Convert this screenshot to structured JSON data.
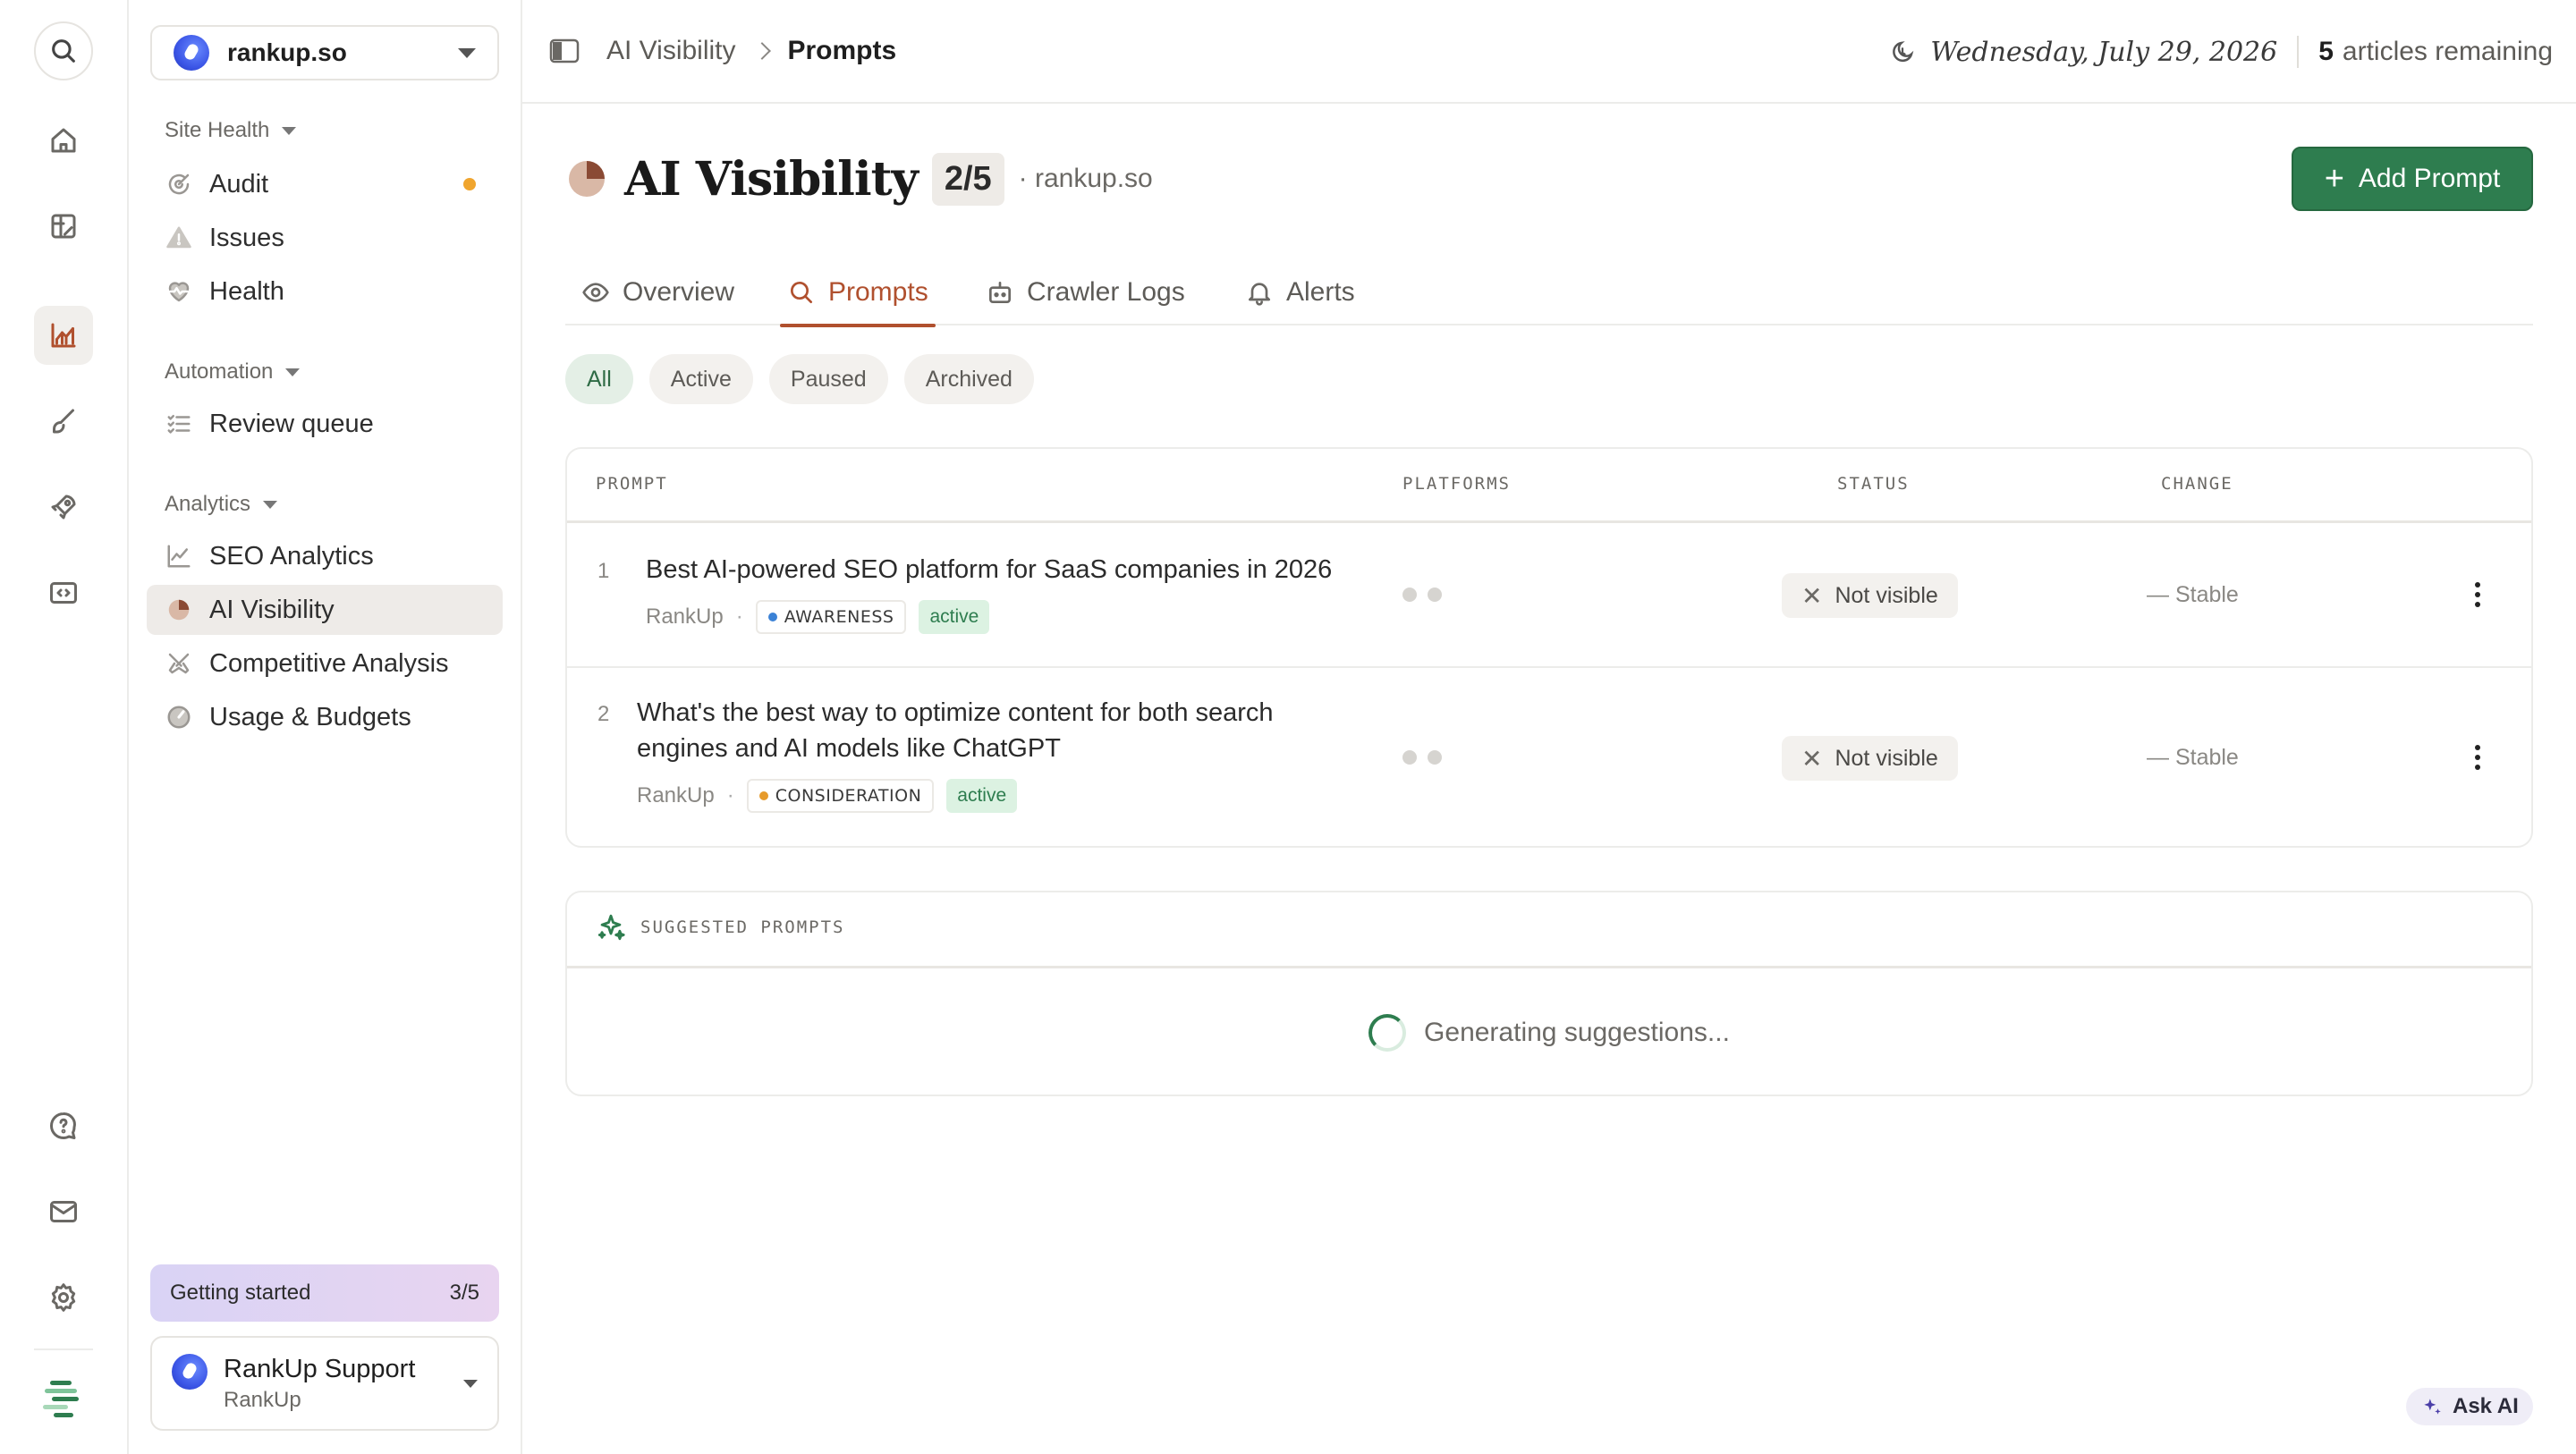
{
  "rail": {
    "items": [
      "search",
      "home",
      "content",
      "analytics",
      "write",
      "launch",
      "embed",
      "help",
      "mail",
      "settings"
    ]
  },
  "site_switcher": {
    "name": "rankup.so"
  },
  "sidebar": {
    "sections": [
      {
        "title": "Site Health",
        "items": [
          {
            "label": "Audit",
            "icon": "audit-icon",
            "indicator": true
          },
          {
            "label": "Issues",
            "icon": "warning-icon"
          },
          {
            "label": "Health",
            "icon": "heart-pulse-icon"
          }
        ]
      },
      {
        "title": "Automation",
        "items": [
          {
            "label": "Review queue",
            "icon": "checklist-icon"
          }
        ]
      },
      {
        "title": "Analytics",
        "items": [
          {
            "label": "SEO Analytics",
            "icon": "line-chart-icon"
          },
          {
            "label": "AI Visibility",
            "icon": "pie-icon",
            "active": true
          },
          {
            "label": "Competitive Analysis",
            "icon": "swords-icon"
          },
          {
            "label": "Usage & Budgets",
            "icon": "gauge-icon"
          }
        ]
      }
    ],
    "getting_started": {
      "label": "Getting started",
      "progress": "3/5"
    },
    "user": {
      "name": "RankUp Support",
      "org": "RankUp"
    }
  },
  "topbar": {
    "breadcrumb": [
      "AI Visibility",
      "Prompts"
    ],
    "date": "Wednesday, July 29, 2026",
    "articles_count": "5",
    "articles_label": "articles remaining"
  },
  "page": {
    "title": "AI Visibility",
    "quota": "2/5",
    "domain": "· rankup.so",
    "add_button": "Add Prompt"
  },
  "tabs": [
    {
      "label": "Overview",
      "icon": "eye-icon"
    },
    {
      "label": "Prompts",
      "icon": "search-icon",
      "active": true
    },
    {
      "label": "Crawler Logs",
      "icon": "robot-icon"
    },
    {
      "label": "Alerts",
      "icon": "bell-icon"
    }
  ],
  "filters": [
    "All",
    "Active",
    "Paused",
    "Archived"
  ],
  "table": {
    "headers": {
      "prompt": "PROMPT",
      "platforms": "PLATFORMS",
      "status": "STATUS",
      "change": "CHANGE"
    },
    "rows": [
      {
        "num": "1",
        "text": "Best AI-powered SEO platform for SaaS companies in 2026",
        "brand": "RankUp",
        "stage": "AWARENESS",
        "stage_color": "#3b82d6",
        "state": "active",
        "status": "Not visible",
        "change": "— Stable"
      },
      {
        "num": "2",
        "text": "What's the best way to optimize content for both search engines and AI models like ChatGPT",
        "brand": "RankUp",
        "stage": "CONSIDERATION",
        "stage_color": "#e69a2a",
        "state": "active",
        "status": "Not visible",
        "change": "— Stable"
      }
    ]
  },
  "suggested": {
    "title": "SUGGESTED PROMPTS",
    "loading": "Generating suggestions..."
  },
  "ask_ai": "Ask AI",
  "colors": {
    "accent": "#b0502e",
    "primary_green": "#2e7d4f"
  }
}
